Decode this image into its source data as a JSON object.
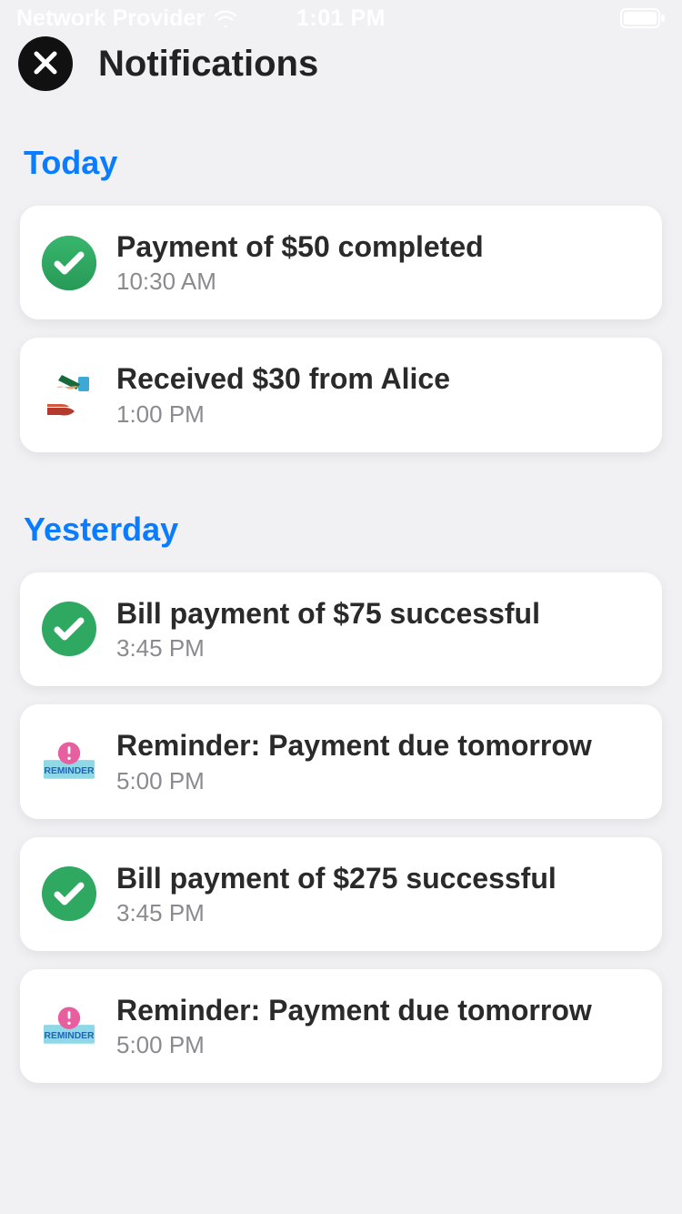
{
  "status": {
    "carrier": "Network Provider",
    "time": "1:01 PM"
  },
  "header": {
    "title": "Notifications"
  },
  "sections": [
    {
      "title": "Today",
      "items": [
        {
          "icon": "check",
          "title": "Payment of $50 completed",
          "time": "10:30 AM"
        },
        {
          "icon": "receive",
          "title": "Received $30 from Alice",
          "time": "1:00 PM"
        }
      ]
    },
    {
      "title": "Yesterday",
      "items": [
        {
          "icon": "check",
          "title": "Bill payment of $75 successful",
          "time": "3:45 PM"
        },
        {
          "icon": "reminder",
          "title": "Reminder: Payment due tomorrow",
          "time": "5:00 PM"
        },
        {
          "icon": "check",
          "title": "Bill payment of $275 successful",
          "time": "3:45 PM"
        },
        {
          "icon": "reminder",
          "title": "Reminder: Payment due tomorrow",
          "time": "5:00 PM"
        }
      ]
    }
  ]
}
